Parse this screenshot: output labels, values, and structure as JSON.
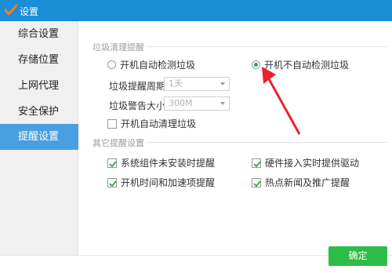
{
  "window": {
    "title": "设置",
    "logo_icon": "app-logo-icon"
  },
  "sidebar": {
    "items": [
      {
        "label": "综合设置"
      },
      {
        "label": "存储位置"
      },
      {
        "label": "上网代理"
      },
      {
        "label": "安全保护"
      },
      {
        "label": "提醒设置",
        "active": true
      }
    ]
  },
  "trash_reminder": {
    "section_title": "垃圾清理提醒",
    "radio_auto_detect": {
      "label": "开机自动检测垃圾",
      "checked": false
    },
    "radio_no_detect": {
      "label": "开机不自动检测垃圾",
      "checked": true
    },
    "period": {
      "label": "垃圾提醒周期",
      "value": "1天"
    },
    "warning_size": {
      "label": "垃圾警告大小",
      "value": "300M"
    },
    "auto_clean": {
      "label": "开机自动清理垃圾",
      "checked": false
    }
  },
  "other_reminders": {
    "section_title": "其它提醒设置",
    "items": [
      {
        "label": "系统组件未安装时提醒",
        "checked": true
      },
      {
        "label": "硬件接入实时提供驱动",
        "checked": true
      },
      {
        "label": "开机时间和加速项提醒",
        "checked": true
      },
      {
        "label": "热点新闻及推广提醒",
        "checked": true
      }
    ]
  },
  "footer": {
    "ok_label": "确定"
  },
  "colors": {
    "titlebar": "#1a8fd8",
    "active_tab": "#4a9fe0",
    "ok_button": "#2ebc49",
    "annotation_arrow": "#e8232f"
  }
}
